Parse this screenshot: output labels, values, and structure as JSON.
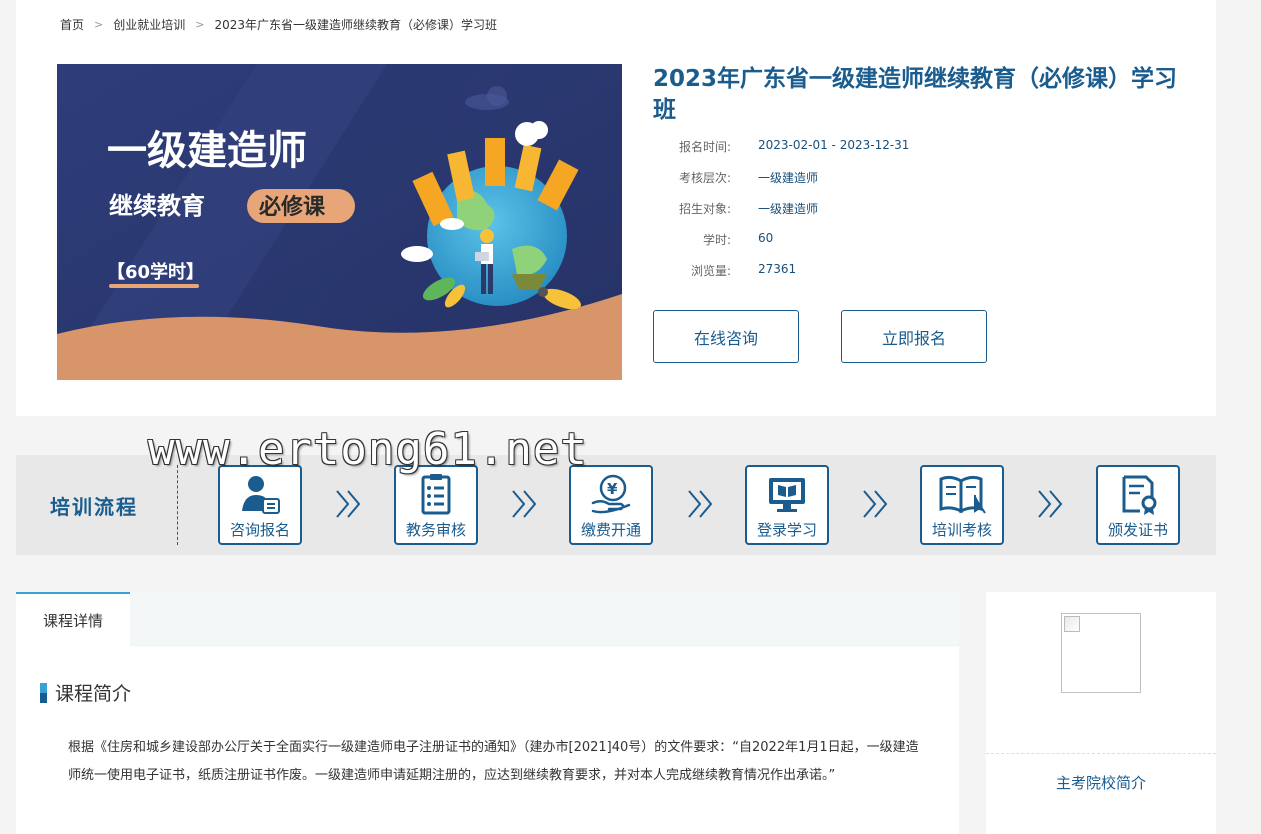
{
  "breadcrumb": {
    "home": "首页",
    "category": "创业就业培训",
    "current": "2023年广东省一级建造师继续教育（必修课）学习班"
  },
  "banner": {
    "line1": "一级建造师",
    "line2": "继续教育",
    "badge": "必修课",
    "hours": "【60学时】"
  },
  "course": {
    "title": "2023年广东省一级建造师继续教育（必修课）学习班",
    "info": [
      {
        "label": "报名时间:",
        "value": "2023-02-01 - 2023-12-31"
      },
      {
        "label": "考核层次:",
        "value": "一级建造师"
      },
      {
        "label": "招生对象:",
        "value": "一级建造师"
      },
      {
        "label": "学时:",
        "value": "60"
      },
      {
        "label": "浏览量:",
        "value": "27361"
      }
    ],
    "consult_label": "在线咨询",
    "enroll_label": "立即报名"
  },
  "watermark": "www.ertong61.net",
  "process": {
    "title": "培训流程",
    "steps": [
      {
        "label": "咨询报名",
        "icon": "user-form-icon"
      },
      {
        "label": "教务审核",
        "icon": "checklist-icon"
      },
      {
        "label": "缴费开通",
        "icon": "yuan-payment-icon"
      },
      {
        "label": "登录学习",
        "icon": "monitor-book-icon"
      },
      {
        "label": "培训考核",
        "icon": "open-book-icon"
      },
      {
        "label": "颁发证书",
        "icon": "certificate-icon"
      }
    ]
  },
  "detail": {
    "tab_label": "课程详情",
    "section_title": "课程简介",
    "text": "根据《住房和城乡建设部办公厅关于全面实行一级建造师电子注册证书的通知》（建办市[2021]40号）的文件要求：“自2022年1月1日起，一级建造师统一使用电子证书，纸质注册证书作废。一级建造师申请延期注册的，应达到继续教育要求，并对本人完成继续教育情况作出承诺。”"
  },
  "sidebar": {
    "title": "主考院校简介"
  },
  "colors": {
    "brand": "#1a5c8e",
    "accent": "#3aa0d6",
    "banner_bg": "#2c3a75",
    "banner_badge": "#e8a678"
  }
}
